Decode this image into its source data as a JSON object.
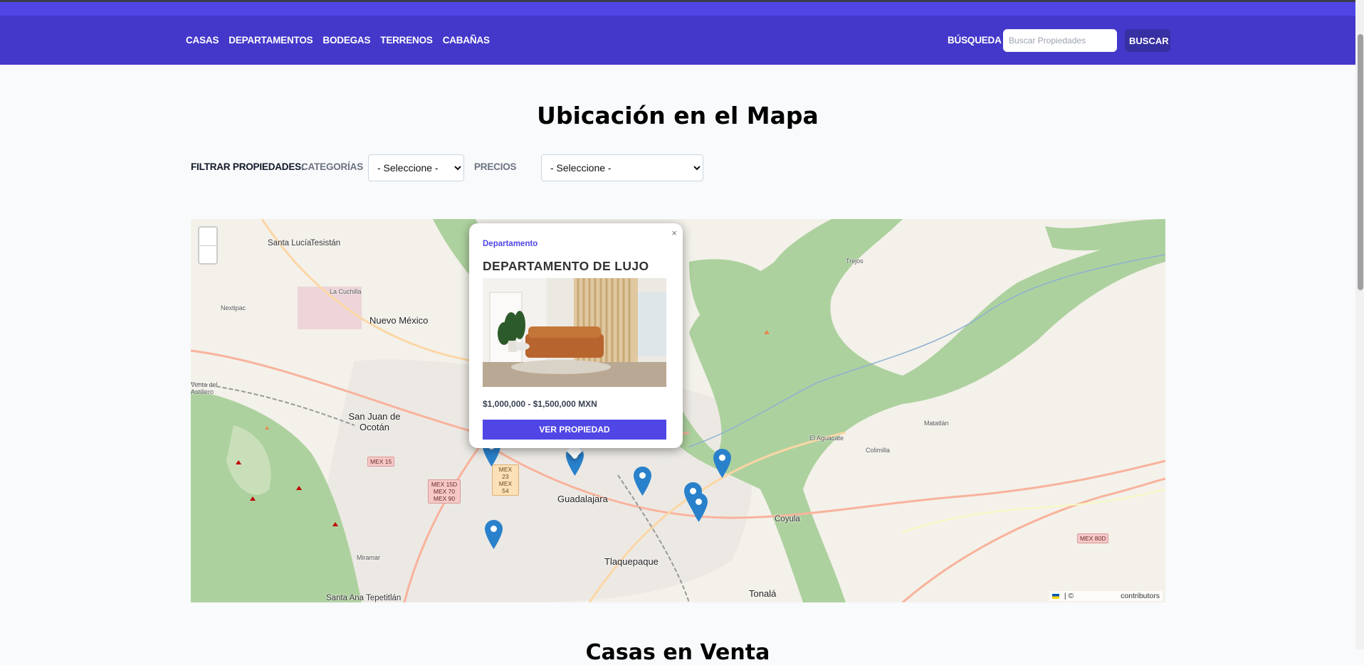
{
  "nav": {
    "links": [
      "CASAS",
      "DEPARTAMENTOS",
      "BODEGAS",
      "TERRENOS",
      "CABAÑAS"
    ],
    "search_label": "BÚSQUEDA",
    "search_placeholder": "Buscar Propiedades",
    "search_button": "BUSCAR"
  },
  "page": {
    "title": "Ubicación en el Mapa",
    "next_section_title": "Casas en Venta"
  },
  "filters": {
    "label": "FILTRAR PROPIEDADES:",
    "category_label": "CATEGORÍAS",
    "category_selected": "- Seleccione -",
    "price_label": "PRECIOS",
    "price_selected": "- Seleccione -"
  },
  "map": {
    "zoom_in": "+",
    "zoom_out": "−",
    "attribution_sep": "| ©",
    "attribution_text": "contributors",
    "places": [
      "Santa Lucía",
      "Tesistán",
      "La Cuchilla",
      "Nextipac",
      "Nuevo México",
      "Venta del Astillero",
      "San Juan de Ocotán",
      "Guadalajara",
      "Tlaquepaque",
      "Tonalá",
      "Santa Ana Tepetitlán",
      "Miramar",
      "Coyula",
      "Matatlán",
      "El Aguacate",
      "Colimilla",
      "Trejos"
    ],
    "highways": [
      "MEX 15",
      "MEX 15D MEX 70 MEX 90",
      "MEX 23 MEX 54",
      "MEX 80D"
    ],
    "markers_count": 8,
    "popup": {
      "category": "Departamento",
      "title": "DEPARTAMENTO DE LUJO",
      "price": "$1,000,000 - $1,500,000 MXN",
      "button": "VER PROPIEDAD",
      "close": "×"
    }
  },
  "colors": {
    "brand": "#4f46e5",
    "navbar": "#4338ca",
    "marker": "#2a81cb"
  }
}
